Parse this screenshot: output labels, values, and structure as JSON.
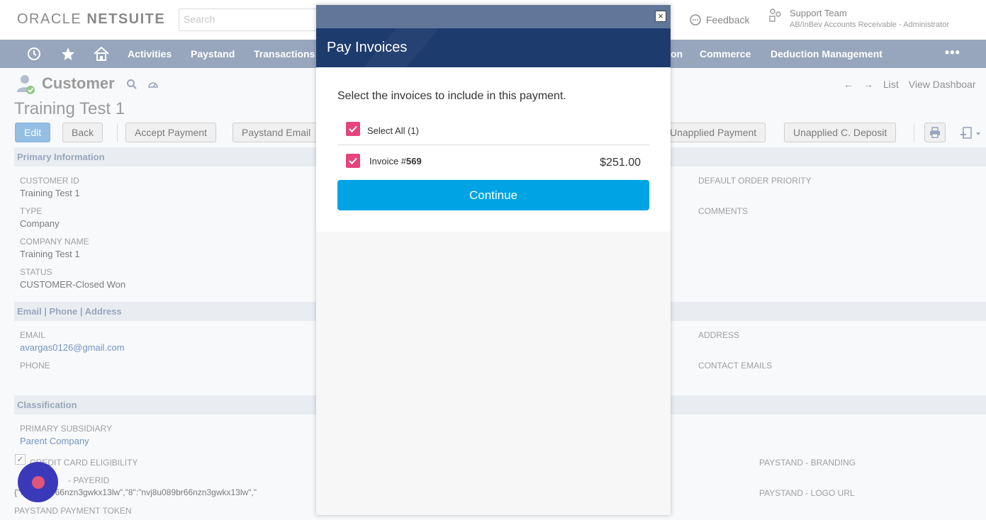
{
  "header": {
    "logo_primary": "ORACLE",
    "logo_secondary": "NETSUITE",
    "search_placeholder": "Search",
    "feedback_label": "Feedback",
    "support_name": "Support Team",
    "support_role": "AB/InBev Accounts Receivable - Administrator"
  },
  "nav": {
    "items": [
      "Activities",
      "Paystand",
      "Transactions",
      "on",
      "Commerce",
      "Deduction Management"
    ],
    "more_label": "•••"
  },
  "record": {
    "type": "Customer",
    "title": "Training Test 1",
    "nav_list": "List",
    "nav_dashboard": "View Dashboar"
  },
  "toolbar": {
    "edit": "Edit",
    "back": "Back",
    "accept_payment": "Accept Payment",
    "paystand_email": "Paystand Email",
    "unapplied_payment": "Unapplied Payment",
    "unapplied_deposit": "Unapplied C. Deposit"
  },
  "sections": {
    "primary": "Primary Information",
    "contact": "Email | Phone | Address",
    "classification": "Classification"
  },
  "fields": {
    "customer_id_label": "CUSTOMER ID",
    "customer_id": "Training Test 1",
    "type_label": "TYPE",
    "type": "Company",
    "company_name_label": "COMPANY NAME",
    "company_name": "Training Test 1",
    "status_label": "STATUS",
    "status": "CUSTOMER-Closed Won",
    "default_order_priority_label": "DEFAULT ORDER PRIORITY",
    "comments_label": "COMMENTS",
    "email_label": "EMAIL",
    "email": "avargas0126@gmail.com",
    "phone_label": "PHONE",
    "address_label": "ADDRESS",
    "contact_emails_label": "CONTACT EMAILS",
    "primary_subsidiary_label": "PRIMARY SUBSIDIARY",
    "primary_subsidiary": "Parent Company",
    "credit_card_label": "CREDIT CARD ELIGIBILITY",
    "payerid_label": "- PAYERID",
    "payerid_value": "{\"…u089br66nzn3gwkx13lw\",\"8\":\"nvj8u089br66nzn3gwkx13lw\",\"",
    "payment_token_label": "PAYSTAND PAYMENT TOKEN",
    "branding_label": "PAYSTAND - BRANDING",
    "logo_url_label": "PAYSTAND - LOGO URL"
  },
  "modal": {
    "title": "Pay Invoices",
    "instruction": "Select the invoices to include in this payment.",
    "select_all_label": "Select All (1)",
    "invoice_prefix": "Invoice #",
    "invoice_number": "569",
    "invoice_amount": "$251.00",
    "continue_label": "Continue",
    "close_glyph": "×"
  },
  "colors": {
    "nav_bg": "#607799",
    "modal_header": "#1e3b6e",
    "checkbox": "#e6457a",
    "continue": "#00a4e4",
    "primary_button": "#5b9bd5"
  }
}
